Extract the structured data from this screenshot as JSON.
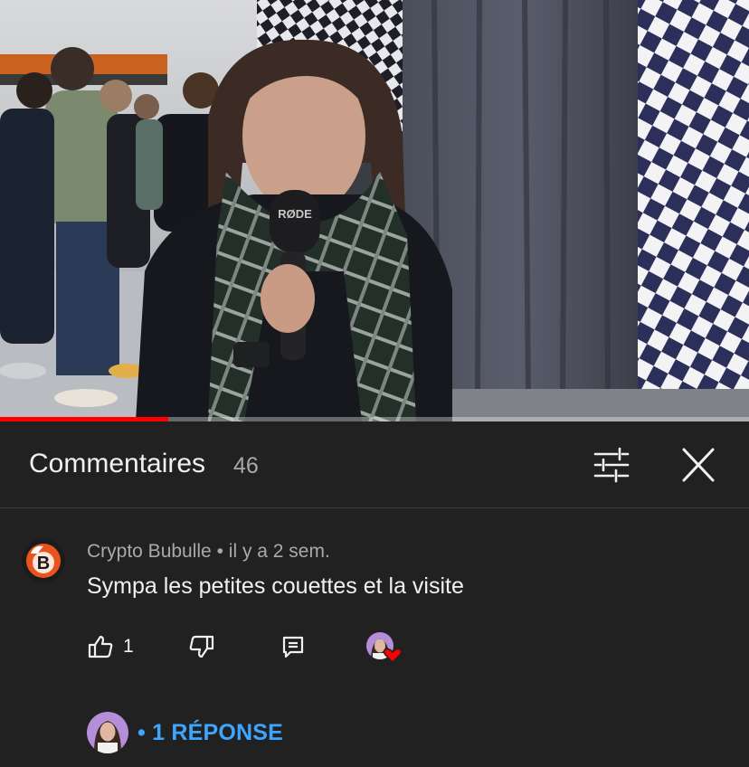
{
  "video": {
    "mic_brand": "RØDE",
    "progress": 0.225,
    "colors": {
      "progress_fill": "#ff0000",
      "progress_track": "#9a9a9a"
    }
  },
  "comments_panel": {
    "title": "Commentaires",
    "count": "46",
    "icons": {
      "filter": "sort-filter-icon",
      "close": "close-icon"
    }
  },
  "comment": {
    "author": "Crypto Bubulle",
    "separator": " • ",
    "age": "il y a 2 sem.",
    "text": "Sympa les petites couettes et la visite",
    "likes": "1",
    "icons": {
      "like": "thumbs-up-icon",
      "dislike": "thumbs-down-icon",
      "reply": "reply-comment-icon",
      "creator_heart": "creator-heart-icon"
    },
    "replies_label": "• 1 RÉPONSE",
    "colors": {
      "replies": "#3ea6ff",
      "heart": "#ff0000",
      "avatar_bg": "#e8541c"
    }
  }
}
